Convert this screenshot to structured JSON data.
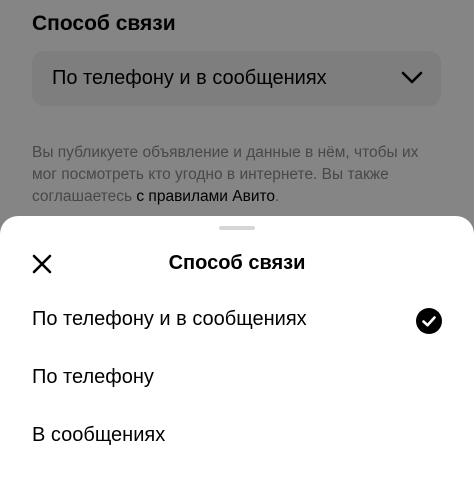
{
  "form": {
    "contact_title": "Способ связи",
    "contact_value": "По телефону и в сообщениях",
    "notice_text_1": "Вы публикуете объявление и данные в нём, чтобы их мог посмотреть кто угодно в интернете. Вы также соглашаетесь ",
    "notice_link": "с правилами Авито",
    "notice_text_2": "."
  },
  "sheet": {
    "title": "Способ связи",
    "options": [
      {
        "label": "По телефону и в сообщениях",
        "selected": true
      },
      {
        "label": "По телефону",
        "selected": false
      },
      {
        "label": "В сообщениях",
        "selected": false
      }
    ]
  },
  "icons": {
    "close": "close-icon",
    "check": "check-circle-icon",
    "chevron": "chevron-down-icon"
  },
  "colors": {
    "overlay": "#000000",
    "select_bg": "#f2f2f2",
    "muted_text": "#8a8a8a",
    "check_fill": "#000000"
  }
}
